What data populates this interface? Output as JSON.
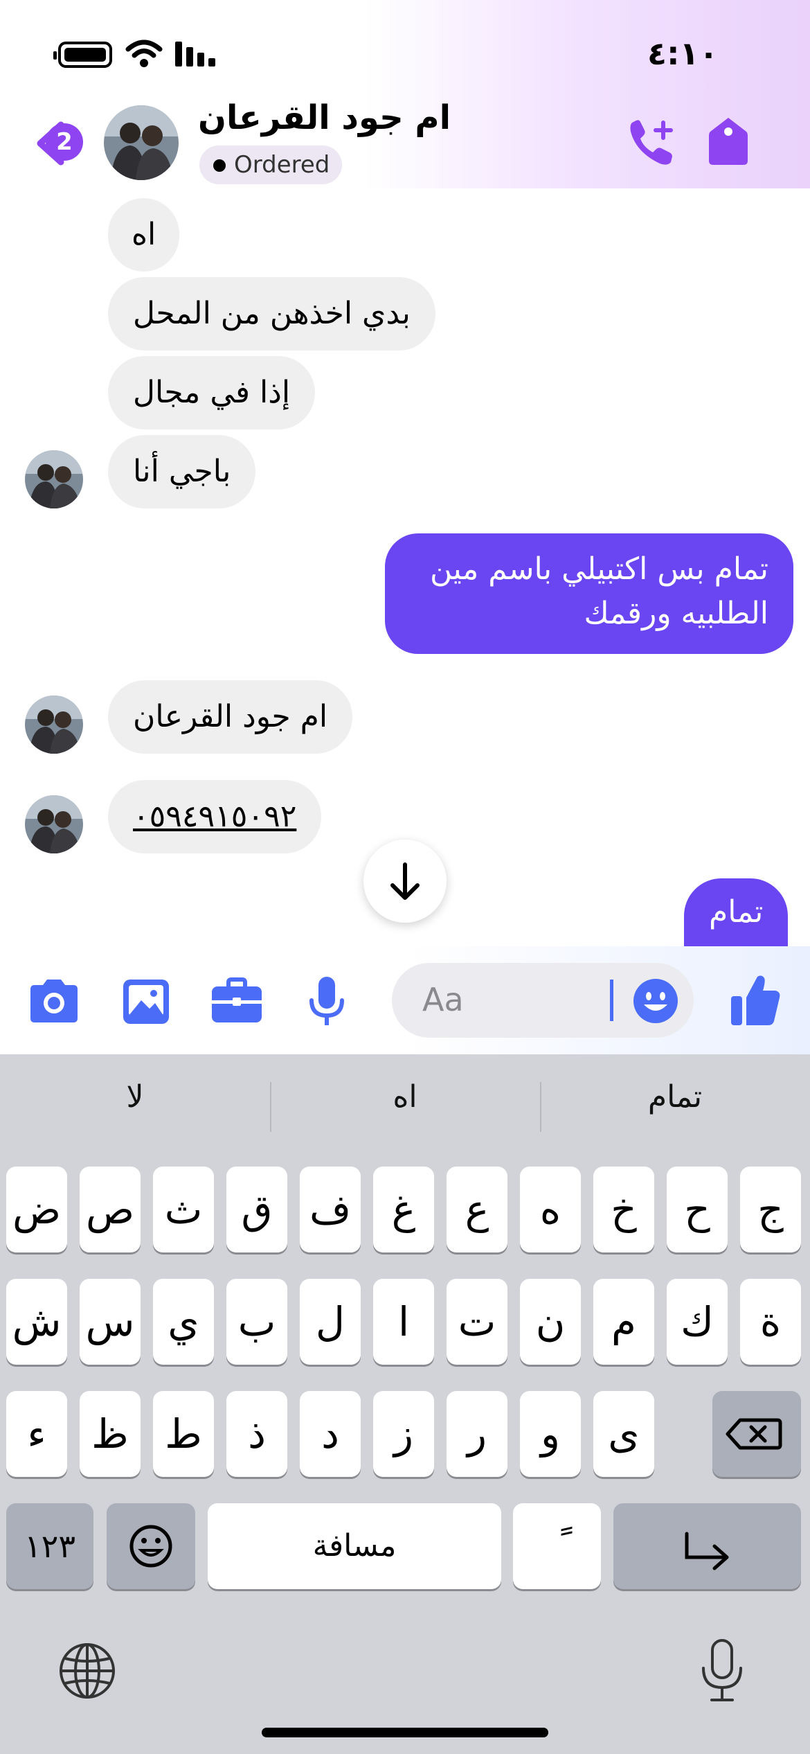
{
  "status": {
    "time": "٤:١٠"
  },
  "header": {
    "back_badge": "2",
    "contact_name": "ام جود القرعان",
    "ordered_label": "Ordered"
  },
  "messages": [
    {
      "dir": "in",
      "text": "اه"
    },
    {
      "dir": "in",
      "text": "بدي اخذهن من المحل"
    },
    {
      "dir": "in",
      "text": "إذا في مجال"
    },
    {
      "dir": "in",
      "text": "باجي أنا"
    },
    {
      "dir": "out",
      "text": "تمام بس اكتبيلي باسم مين الطلبيه ورقمك"
    },
    {
      "dir": "in",
      "text": "ام جود القرعان"
    },
    {
      "dir": "in",
      "text": "٠٥٩٤٩١٥٠٩٢"
    },
    {
      "dir": "out",
      "text": "تمام"
    }
  ],
  "composer": {
    "placeholder": "Aa"
  },
  "keyboard": {
    "suggestions": [
      "لا",
      "اه",
      "تمام"
    ],
    "row1": [
      "ض",
      "ص",
      "ث",
      "ق",
      "ف",
      "غ",
      "ع",
      "ه",
      "خ",
      "ح",
      "ج"
    ],
    "row2": [
      "ش",
      "س",
      "ي",
      "ب",
      "ل",
      "ا",
      "ت",
      "ن",
      "م",
      "ك",
      "ة"
    ],
    "row3": [
      "ء",
      "ظ",
      "ط",
      "ذ",
      "د",
      "ز",
      "ر",
      "و",
      "ى"
    ],
    "numbers_key": "١٢٣",
    "space_key": "مسافة",
    "diacritic_key": "ً"
  },
  "colors": {
    "accent": "#8e44f0",
    "outgoing_bubble": "#6a45f2",
    "composer_icons": "#4a6cf7"
  }
}
